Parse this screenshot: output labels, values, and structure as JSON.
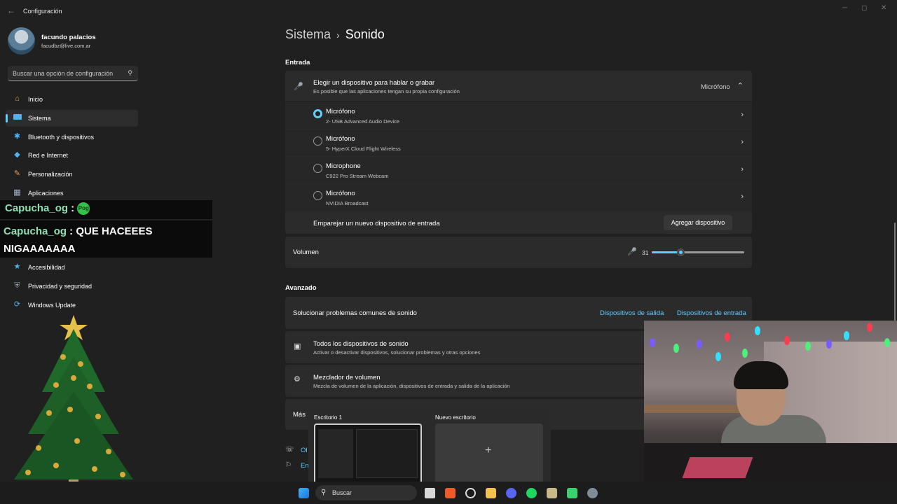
{
  "window": {
    "title": "Configuración",
    "back": "←",
    "minimize": "─",
    "maximize": "◻",
    "close": "✕"
  },
  "user": {
    "name": "facundo palacios",
    "email": "facudbz@live.com.ar"
  },
  "search": {
    "placeholder": "Buscar una opción de configuración"
  },
  "nav": [
    {
      "label": "Inicio",
      "icon": "home-icon"
    },
    {
      "label": "Sistema",
      "icon": "system-icon",
      "active": true
    },
    {
      "label": "Bluetooth y dispositivos",
      "icon": "bluetooth-icon"
    },
    {
      "label": "Red e Internet",
      "icon": "wifi-icon"
    },
    {
      "label": "Personalización",
      "icon": "brush-icon"
    },
    {
      "label": "Aplicaciones",
      "icon": "apps-icon"
    },
    {
      "label": "Accesibilidad",
      "icon": "accessibility-icon"
    },
    {
      "label": "Privacidad y seguridad",
      "icon": "shield-icon"
    },
    {
      "label": "Windows Update",
      "icon": "update-icon"
    }
  ],
  "chat": [
    {
      "user": "Capucha_og",
      "sep": " : ",
      "text": "",
      "emote": "Pog"
    },
    {
      "user": "Capucha_og",
      "sep": " : ",
      "text": "QUE HACEEES",
      "text2": "NIGAAAAAAA"
    }
  ],
  "breadcrumb": {
    "parent": "Sistema",
    "separator": "›",
    "current": "Sonido"
  },
  "input": {
    "section": "Entrada",
    "chooser": {
      "title": "Elegir un dispositivo para hablar o grabar",
      "subtitle": "Es posible que las aplicaciones tengan su propia configuración",
      "value": "Micrófono"
    },
    "devices": [
      {
        "name": "Micrófono",
        "detail": "2- USB Advanced Audio Device",
        "selected": true
      },
      {
        "name": "Micrófono",
        "detail": "5- HyperX Cloud Flight Wireless",
        "selected": false
      },
      {
        "name": "Microphone",
        "detail": "C922 Pro Stream Webcam",
        "selected": false
      },
      {
        "name": "Micrófono",
        "detail": "NVIDIA Broadcast",
        "selected": false
      }
    ],
    "pair": {
      "label": "Emparejar un nuevo dispositivo de entrada",
      "button": "Agregar dispositivo"
    },
    "volume": {
      "label": "Volumen",
      "value": "31",
      "level": 0.31
    }
  },
  "advanced": {
    "section": "Avanzado",
    "troubleshoot": {
      "label": "Solucionar problemas comunes de sonido",
      "link_out": "Dispositivos de salida",
      "link_in": "Dispositivos de entrada"
    },
    "all_devices": {
      "title": "Todos los dispositivos de sonido",
      "subtitle": "Activar o desactivar dispositivos, solucionar problemas y otras opciones"
    },
    "mixer": {
      "title": "Mezclador de volumen",
      "subtitle": "Mezcla de volumen de la aplicación, dispositivos de entrada y salida de la aplicación"
    },
    "more": "Más",
    "help1": "Ol",
    "help2": "En"
  },
  "taskview": {
    "desktop1": "Escritorio 1",
    "new_desktop": "Nuevo escritorio",
    "plus": "+"
  },
  "taskbar": {
    "search": "Buscar"
  },
  "colors": {
    "accent": "#60cdff",
    "background": "#202020",
    "card": "#2b2b2b"
  }
}
